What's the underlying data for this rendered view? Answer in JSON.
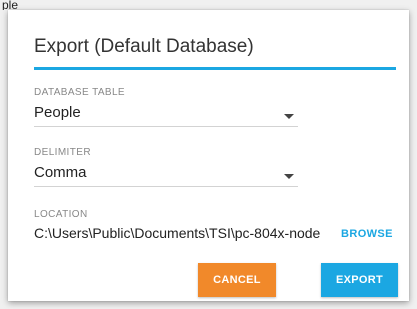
{
  "background_fragment": "ple",
  "dialog": {
    "title": "Export (Default Database)",
    "database_table": {
      "label": "DATABASE TABLE",
      "value": "People"
    },
    "delimiter": {
      "label": "DELIMITER",
      "value": "Comma"
    },
    "location": {
      "label": "LOCATION",
      "value": "C:\\Users\\Public\\Documents\\TSI\\pc-804x-node",
      "browse_label": "BROWSE"
    },
    "buttons": {
      "cancel_label": "CANCEL",
      "export_label": "EXPORT"
    }
  },
  "colors": {
    "accent": "#1ba7e2",
    "cancel": "#f1892a"
  }
}
